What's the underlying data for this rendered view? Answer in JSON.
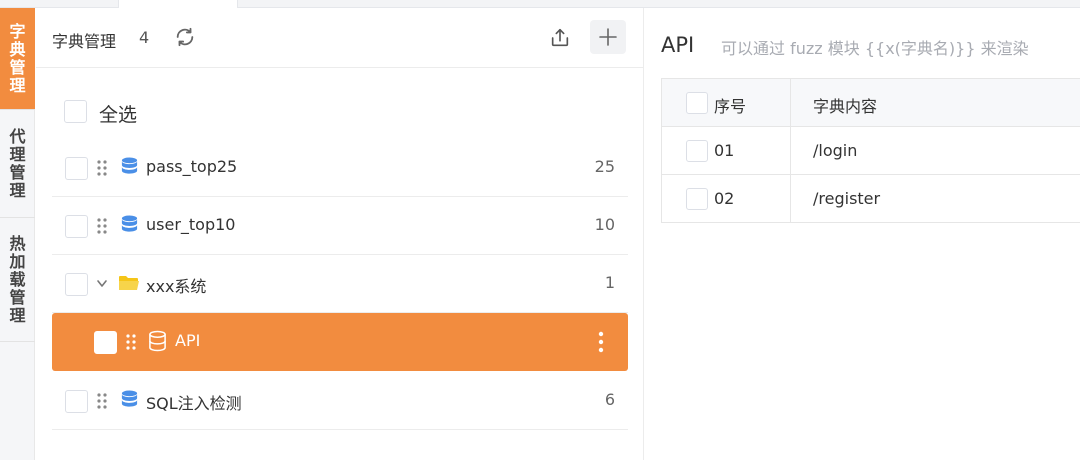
{
  "vertical_tabs": [
    {
      "label": "字典管理",
      "active": true
    },
    {
      "label": "代理管理",
      "active": false
    },
    {
      "label": "热加载管理",
      "active": false
    }
  ],
  "left_panel": {
    "title": "字典管理",
    "count": "4",
    "select_all_label": "全选",
    "items": [
      {
        "name": "pass_top25",
        "count": "25",
        "icon": "database-icon"
      },
      {
        "name": "user_top10",
        "count": "10",
        "icon": "database-icon"
      },
      {
        "name": "xxx系统",
        "count": "1",
        "icon": "folder-open-icon"
      },
      {
        "name": "API",
        "count": "",
        "icon": "database-icon"
      },
      {
        "name": "SQL注入检测",
        "count": "6",
        "icon": "database-icon"
      }
    ]
  },
  "right_panel": {
    "title": "API",
    "hint": "可以通过 fuzz 模块 {{x(字典名)}} 来渲染",
    "table": {
      "headers": [
        "序号",
        "字典内容"
      ],
      "rows": [
        {
          "index": "01",
          "content": "/login"
        },
        {
          "index": "02",
          "content": "/register"
        }
      ]
    }
  },
  "colors": {
    "accent": "#f28c3f",
    "database_icon": "#4a8fe7",
    "folder_icon": "#f5c518"
  }
}
